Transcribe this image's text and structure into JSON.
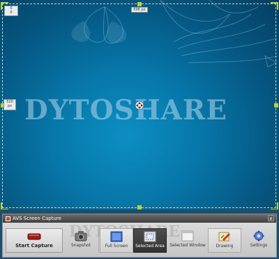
{
  "desktop": {
    "watermark": "DYTOSHARE",
    "width_label": "696 px",
    "height_label": "520 px",
    "corner_label": "0\n0"
  },
  "app": {
    "title": "AVS Screen Capture",
    "close_glyph": "x",
    "watermark": "DYTOSHARE"
  },
  "toolbar": {
    "start_label": "Start Capture",
    "snapshot_label": "Snapshot",
    "fullscreen_label": "Full Screen",
    "selected_area_label": "Selected Area",
    "selected_window_label": "Selected Window",
    "drawing_label": "Drawing",
    "settings_label": "Settings"
  },
  "colors": {
    "accent": "#b9d23d",
    "desktop": "#0776a8",
    "selected_button": "#3b3b3b"
  }
}
